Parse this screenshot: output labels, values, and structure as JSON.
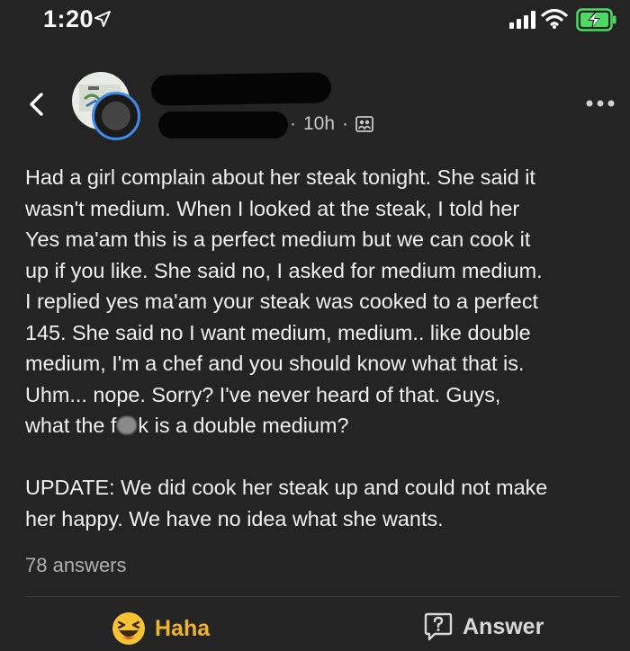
{
  "status_bar": {
    "time": "1:20"
  },
  "post": {
    "timestamp": "10h",
    "separator": "·",
    "body_lines": [
      "Had a girl complain about her steak tonight. She said it",
      "wasn't medium. When I looked at the steak, I told her",
      "Yes ma'am this is a perfect medium but we can cook it",
      "up if you like. She said no, I asked for medium medium.",
      "I replied yes ma'am your steak was cooked to a perfect",
      "145. She said no I want medium, medium.. like double",
      "medium, I'm a chef and you should know what that is.",
      "Uhm... nope. Sorry? I've never heard of that. Guys,"
    ],
    "last_line_before": "what the f",
    "last_line_after": "k is a double medium?",
    "update_lines": [
      "UPDATE: We did cook her steak up and could not make",
      "her happy. We have no idea what she wants."
    ],
    "answers_count": "78 answers"
  },
  "actions": {
    "reaction_label": "Haha",
    "answer_label": "Answer"
  },
  "icons": {
    "back": "chevron-left-icon",
    "more": "more-horizontal-icon",
    "audience": "people-icon",
    "reaction": "laughing-emoji-icon",
    "answer": "question-bubble-icon"
  },
  "colors": {
    "background": "#242424",
    "accent_ring": "#3f8be8",
    "haha": "#f0b429",
    "battery": "#4cd964"
  }
}
